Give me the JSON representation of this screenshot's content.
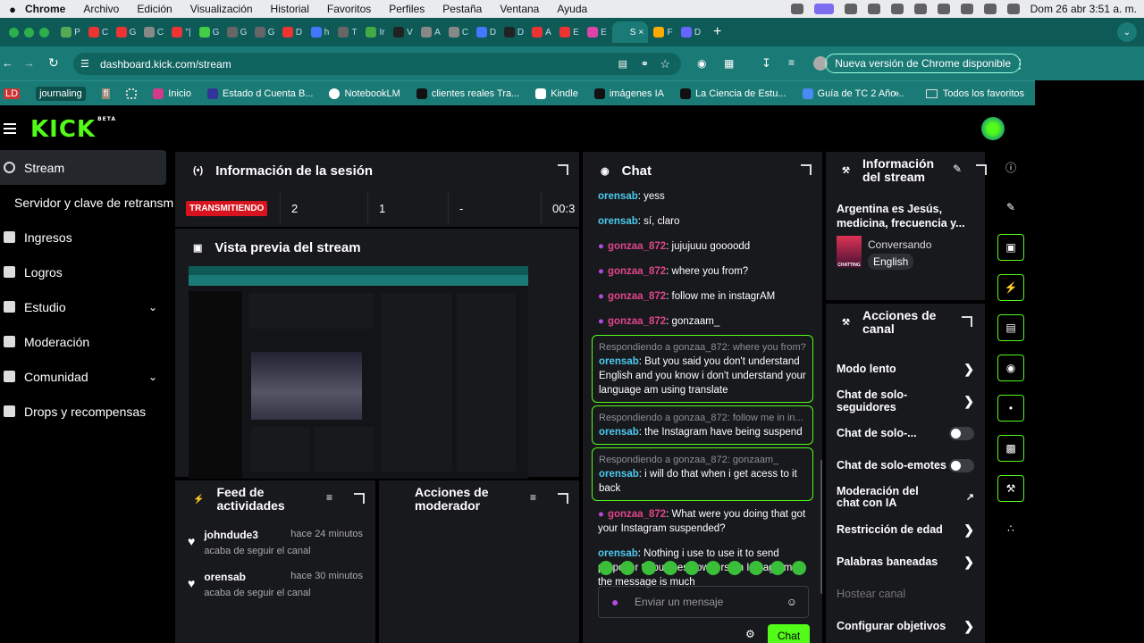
{
  "menubar": {
    "app": "Chrome",
    "items": [
      "Archivo",
      "Edición",
      "Visualización",
      "Historial",
      "Favoritos",
      "Perfiles",
      "Pestaña",
      "Ventana",
      "Ayuda"
    ],
    "clock": "Dom 26 abr  3:51 a. m."
  },
  "tabs": [
    "P",
    "C",
    "G",
    "C",
    "\"|",
    "G",
    "G",
    "G",
    "D",
    "h",
    "T",
    "Ir",
    "V",
    "A",
    "C",
    "D",
    "D",
    "A",
    "E",
    "E",
    "S",
    "F",
    "D"
  ],
  "address": {
    "url": "dashboard.kick.com/stream",
    "update": "Nueva versión de Chrome disponible"
  },
  "bookmarks": {
    "items": [
      "journaling",
      "fl",
      "Inicio",
      "Estado d Cuenta B...",
      "NotebookLM",
      "clientes reales Tra...",
      "Kindle",
      "imágenes IA",
      "La Ciencia de Estu...",
      "Guía de TC 2 Año..."
    ],
    "all": "Todos los favoritos",
    "left_tag": "LD"
  },
  "site": {
    "logo": "KICK",
    "logo_beta": "BETA"
  },
  "sidebar": {
    "items": [
      {
        "label": "Stream"
      },
      {
        "label": "Servidor y clave de retransmisión"
      },
      {
        "label": "Ingresos"
      },
      {
        "label": "Logros"
      },
      {
        "label": "Estudio"
      },
      {
        "label": "Moderación"
      },
      {
        "label": "Comunidad"
      },
      {
        "label": "Drops y recompensas"
      }
    ]
  },
  "session": {
    "title": "Información de la sesión",
    "status": "TRANSMITIENDO",
    "viewers": "2",
    "followers": "1",
    "dash": "-",
    "time": "00:3"
  },
  "preview": {
    "title": "Vista previa del stream"
  },
  "feed": {
    "title": "Feed de actividades",
    "items": [
      {
        "name": "johndude3",
        "time": "hace 24 minutos",
        "action": "acaba de seguir el canal"
      },
      {
        "name": "orensab",
        "time": "hace 30 minutos",
        "action": "acaba de seguir el canal"
      }
    ]
  },
  "modactions": {
    "title": "Acciones de moderador"
  },
  "chat": {
    "title": "Chat",
    "m1_user": "orensab",
    "m1_text": ": yess",
    "m2_user": "orensab",
    "m2_text": ": sí, claro",
    "m3_user": "gonzaa_872",
    "m3_text": ": jujujuuu goooodd",
    "m4_user": "gonzaa_872",
    "m4_text": ": where you from?",
    "m5_user": "gonzaa_872",
    "m5_text": ": follow me in instagrAM",
    "m6_user": "gonzaa_872",
    "m6_text": ": gonzaam_",
    "r1_label": "Respondiendo a gonzaa_872: where you from?",
    "r1_user": "orensab",
    "r1_text": ": But you said you don't understand English and you know i don't understand your language am using translate",
    "r2_label": "Respondiendo a gonzaa_872: follow me in in...",
    "r2_user": "orensab",
    "r2_text": ": the Instagram have being suspend",
    "r3_label": "Respondiendo a gonzaa_872: gonzaam_",
    "r3_user": "orensab",
    "r3_text": ": i will do that when i get acess to it back",
    "m7_user": "gonzaa_872",
    "m7_text": ": What were you doing that got your Instagram suspended?",
    "m8_user": "orensab",
    "m8_text": ": Nothing i use to use it to send proposer to business owners on Instagram so the message is much",
    "placeholder": "Enviar un mensaje",
    "send": "Chat"
  },
  "streaminfo": {
    "title": "Información del stream",
    "stream_title": "Argentina es Jesús, medicina, frecuencia y...",
    "category": "Conversando",
    "language": "English",
    "thumb_label": "CHATTING"
  },
  "channel": {
    "title": "Acciones de canal",
    "items": [
      {
        "label": "Modo lento"
      },
      {
        "label": "Chat de solo-seguidores"
      },
      {
        "label": "Chat de solo-..."
      },
      {
        "label": "Chat de solo-emotes"
      },
      {
        "label": "Moderación del chat con IA"
      },
      {
        "label": "Restricción de edad"
      },
      {
        "label": "Palabras baneadas"
      },
      {
        "label": "Hostear canal"
      },
      {
        "label": "Configurar objetivos"
      }
    ]
  },
  "colors": {
    "accent": "#53fc18",
    "live": "#d6131e",
    "browser": "#1a7a75",
    "panel": "#18191c"
  }
}
